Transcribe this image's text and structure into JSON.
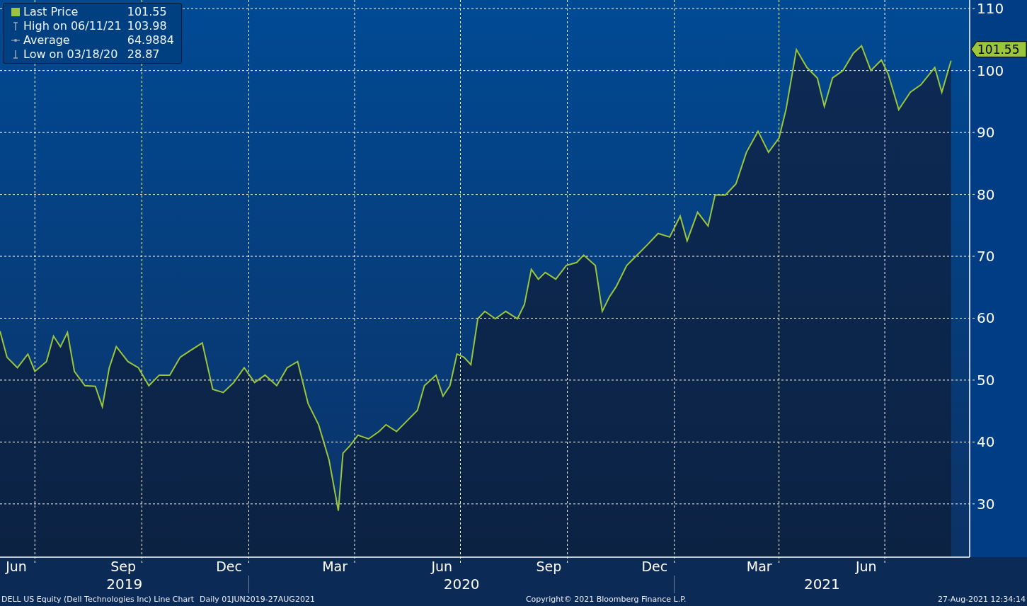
{
  "chart": {
    "legend": [
      {
        "kind": "series",
        "value": "101.55"
      },
      {
        "kind": "high",
        "label": "High on 06/11/21",
        "value": "103.98"
      },
      {
        "kind": "average",
        "label": "Average",
        "value": "64.9884"
      },
      {
        "kind": "low",
        "label": "Low on 03/18/20",
        "value": "28.87"
      }
    ],
    "last_price_tag": "101.55",
    "year_labels": [
      "2019",
      "2020",
      "2021"
    ],
    "chart_data": {
      "type": "area",
      "grid": true,
      "xlim": [
        "2019-06-01",
        "2021-09-12"
      ],
      "ylim": [
        21.4,
        111.4
      ],
      "yticks": [
        30,
        40,
        50,
        60,
        70,
        80,
        90,
        100,
        110
      ],
      "xticks": [
        {
          "value": "2019-06-15",
          "label": "Jun"
        },
        {
          "value": "2019-09-15",
          "label": "Sep"
        },
        {
          "value": "2019-12-15",
          "label": "Dec"
        },
        {
          "value": "2020-03-15",
          "label": "Mar"
        },
        {
          "value": "2020-06-15",
          "label": "Jun"
        },
        {
          "value": "2020-09-15",
          "label": "Sep"
        },
        {
          "value": "2020-12-15",
          "label": "Dec"
        },
        {
          "value": "2021-03-15",
          "label": "Mar"
        },
        {
          "value": "2021-06-15",
          "label": "Jun"
        }
      ],
      "x": [
        "2019-06-01",
        "2019-06-07",
        "2019-06-16",
        "2019-06-25",
        "2019-07-01",
        "2019-07-11",
        "2019-07-17",
        "2019-07-23",
        "2019-07-29",
        "2019-08-04",
        "2019-08-13",
        "2019-08-22",
        "2019-08-28",
        "2019-09-03",
        "2019-09-09",
        "2019-09-19",
        "2019-09-28",
        "2019-10-07",
        "2019-10-16",
        "2019-10-25",
        "2019-11-03",
        "2019-11-12",
        "2019-11-22",
        "2019-12-01",
        "2019-12-10",
        "2019-12-19",
        "2019-12-28",
        "2020-01-06",
        "2020-01-15",
        "2020-01-25",
        "2020-02-03",
        "2020-02-12",
        "2020-02-21",
        "2020-03-01",
        "2020-03-10",
        "2020-03-18",
        "2020-03-22",
        "2020-03-28",
        "2020-04-04",
        "2020-04-13",
        "2020-04-22",
        "2020-04-28",
        "2020-05-07",
        "2020-05-16",
        "2020-05-25",
        "2020-05-31",
        "2020-06-10",
        "2020-06-16",
        "2020-06-22",
        "2020-06-28",
        "2020-07-04",
        "2020-07-10",
        "2020-07-16",
        "2020-07-22",
        "2020-07-31",
        "2020-08-09",
        "2020-08-19",
        "2020-08-25",
        "2020-08-31",
        "2020-09-06",
        "2020-09-12",
        "2020-09-21",
        "2020-09-30",
        "2020-10-09",
        "2020-10-15",
        "2020-10-25",
        "2020-10-31",
        "2020-11-06",
        "2020-11-12",
        "2020-11-21",
        "2020-11-30",
        "2020-12-09",
        "2020-12-18",
        "2020-12-28",
        "2021-01-06",
        "2021-01-12",
        "2021-01-21",
        "2021-01-30",
        "2021-02-05",
        "2021-02-14",
        "2021-02-23",
        "2021-03-04",
        "2021-03-14",
        "2021-03-23",
        "2021-04-01",
        "2021-04-07",
        "2021-04-16",
        "2021-04-25",
        "2021-05-04",
        "2021-05-10",
        "2021-05-17",
        "2021-05-26",
        "2021-06-04",
        "2021-06-11",
        "2021-06-19",
        "2021-06-28",
        "2021-07-04",
        "2021-07-13",
        "2021-07-23",
        "2021-08-01",
        "2021-08-13",
        "2021-08-19",
        "2021-08-27"
      ],
      "series": [
        {
          "name": "Last Price",
          "color": "#9bc53d",
          "values": [
            57.9,
            53.7,
            52,
            54.2,
            51.4,
            53,
            57.1,
            55.4,
            57.7,
            51.4,
            49.1,
            49,
            45.7,
            52,
            55.4,
            53,
            52,
            49.1,
            50.8,
            50.8,
            53.7,
            54.8,
            56,
            48.5,
            48,
            49.6,
            52,
            49.6,
            50.8,
            49.1,
            52,
            53,
            46.2,
            42.8,
            37.1,
            28.9,
            38.2,
            39.4,
            41.1,
            40.5,
            41.7,
            42.8,
            41.7,
            43.4,
            45.1,
            49.1,
            50.8,
            47.4,
            49.1,
            54.2,
            53.7,
            52.5,
            59.9,
            61.1,
            59.9,
            61.1,
            59.9,
            62.2,
            67.9,
            66.3,
            67.4,
            66.3,
            68.5,
            69,
            70.2,
            68.5,
            61.1,
            63.4,
            65.1,
            68.5,
            70.2,
            71.9,
            73.7,
            73.1,
            76.5,
            72.5,
            77.1,
            74.9,
            79.9,
            79.9,
            81.7,
            86.8,
            90.2,
            86.8,
            89.1,
            93.7,
            103.4,
            100.5,
            98.8,
            94.2,
            98.8,
            100,
            102.8,
            104,
            100,
            101.7,
            99.4,
            93.7,
            96.5,
            97.7,
            100.5,
            96.5,
            101.6
          ]
        }
      ]
    }
  },
  "footer": {
    "description": "DELL US Equity (Dell Technologies Inc) Line Chart",
    "range": "Daily 01JUN2019-27AUG2021",
    "copyright": "Copyright© 2021 Bloomberg Finance L.P.",
    "timestamp": "27-Aug-2021 12:34:14"
  }
}
